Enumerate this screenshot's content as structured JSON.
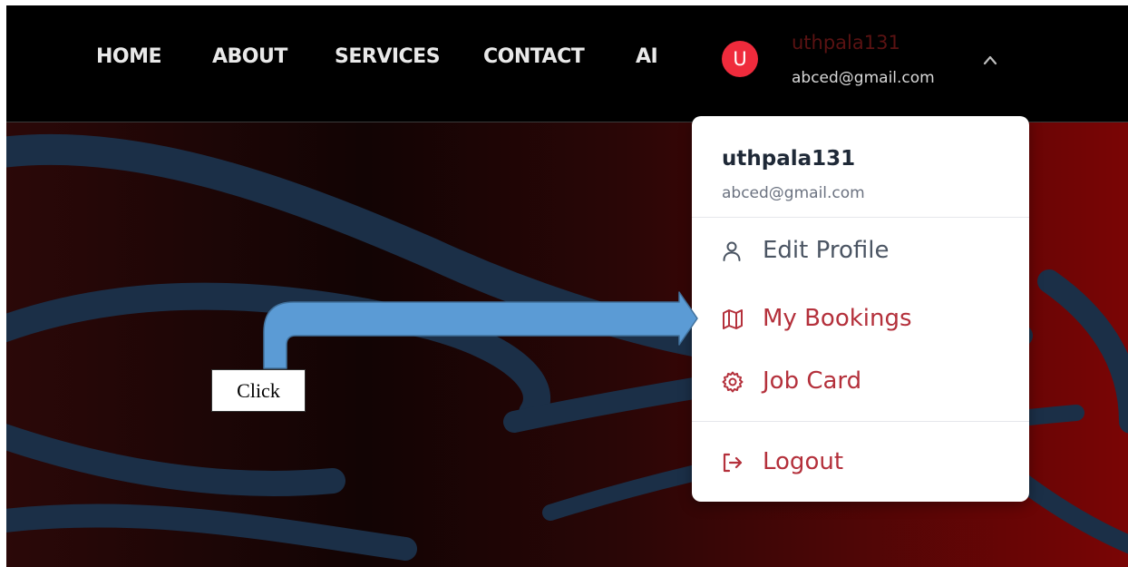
{
  "nav": {
    "links": [
      "HOME",
      "ABOUT",
      "SERVICES",
      "CONTACT",
      "AI"
    ],
    "user": {
      "avatar_letter": "U",
      "username": "uthpala131",
      "email": "abced@gmail.com"
    }
  },
  "dropdown": {
    "username": "uthpala131",
    "email": "abced@gmail.com",
    "items": [
      {
        "label": "Edit Profile",
        "icon": "user-icon"
      },
      {
        "label": "My Bookings",
        "icon": "map-icon"
      },
      {
        "label": "Job Card",
        "icon": "gear-icon"
      },
      {
        "label": "Logout",
        "icon": "logout-icon"
      }
    ]
  },
  "annotation": {
    "label": "Click"
  },
  "colors": {
    "avatar_bg": "#ef2b3c",
    "nav_username": "#5a1212",
    "primary_text": "#4b5563",
    "accent_red": "#b4303b",
    "arrow_fill": "#5b9bd5",
    "arrow_stroke": "#41719c"
  }
}
